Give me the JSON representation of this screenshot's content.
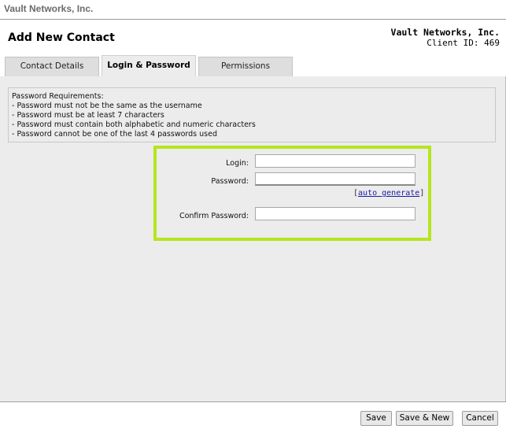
{
  "app": {
    "brand": "Vault Networks, Inc."
  },
  "header": {
    "title": "Add New Contact",
    "client_name": "Vault Networks, Inc.",
    "client_id": "Client ID: 469"
  },
  "tabs": [
    {
      "label": "Contact Details",
      "active": false
    },
    {
      "label": "Login & Password",
      "active": true
    },
    {
      "label": "Permissions",
      "active": false
    }
  ],
  "requirements": {
    "heading": "Password Requirements:",
    "lines": [
      "- Password must not be the same as the username",
      "- Password must be at least 7 characters",
      "- Password must contain both alphabetic and numeric characters",
      "- Password cannot be one of the last 4 passwords used"
    ]
  },
  "form": {
    "login_label": "Login:",
    "login_value": "",
    "password_label": "Password:",
    "password_value": "",
    "auto_generate_open": "[",
    "auto_generate_label": "auto generate",
    "auto_generate_close": "]",
    "confirm_label": "Confirm Password:",
    "confirm_value": "",
    "highlight_color": "#b5e61d"
  },
  "footer": {
    "save_label": "Save",
    "save_new_label": "Save & New",
    "cancel_label": "Cancel"
  }
}
